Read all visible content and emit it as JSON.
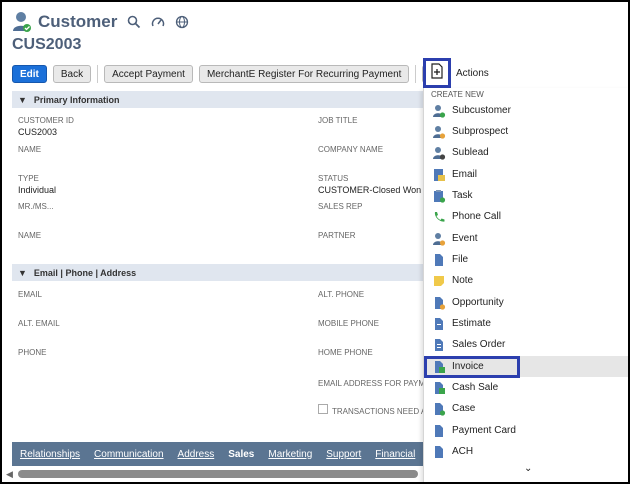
{
  "header": {
    "title": "Customer",
    "record_id": "CUS2003",
    "icons": [
      "customer-person-icon",
      "search-icon",
      "dashboard-gauge-icon",
      "globe-icon"
    ]
  },
  "toolbar": {
    "edit": "Edit",
    "back": "Back",
    "accept_payment": "Accept Payment",
    "merchant_register": "MerchantE Register For Recurring Payment",
    "actions": "Actions"
  },
  "primary": {
    "section_title": "Primary Information",
    "customer_id_label": "CUSTOMER ID",
    "customer_id_value": "CUS2003",
    "job_title_label": "JOB TITLE",
    "name_label": "NAME",
    "company_name_label": "COMPANY NAME",
    "type_label": "TYPE",
    "type_value": "Individual",
    "status_label": "STATUS",
    "status_value": "CUSTOMER-Closed Won",
    "mr_label": "MR./MS...",
    "sales_rep_label": "SALES REP",
    "name2_label": "NAME",
    "partner_label": "PARTNER"
  },
  "contact": {
    "section_title": "Email | Phone | Address",
    "email_label": "EMAIL",
    "alt_phone_label": "ALT. PHONE",
    "alt_email_label": "ALT. EMAIL",
    "mobile_label": "MOBILE PHONE",
    "phone_label": "PHONE",
    "home_phone_label": "HOME PHONE",
    "email_payment_label": "EMAIL ADDRESS FOR PAYME",
    "transactions_label": "TRANSACTIONS NEED AP"
  },
  "tabs": [
    "Relationships",
    "Communication",
    "Address",
    "Sales",
    "Marketing",
    "Support",
    "Financial"
  ],
  "active_tab": "Sales",
  "menu": {
    "header": "CREATE NEW",
    "items": [
      {
        "label": "Subcustomer",
        "icon": "customer-icon"
      },
      {
        "label": "Subprospect",
        "icon": "prospect-icon"
      },
      {
        "label": "Sublead",
        "icon": "lead-icon"
      },
      {
        "label": "Email",
        "icon": "email-icon"
      },
      {
        "label": "Task",
        "icon": "task-icon"
      },
      {
        "label": "Phone Call",
        "icon": "phone-icon"
      },
      {
        "label": "Event",
        "icon": "event-icon"
      },
      {
        "label": "File",
        "icon": "file-icon"
      },
      {
        "label": "Note",
        "icon": "note-icon"
      },
      {
        "label": "Opportunity",
        "icon": "opportunity-icon"
      },
      {
        "label": "Estimate",
        "icon": "estimate-icon"
      },
      {
        "label": "Sales Order",
        "icon": "sales-order-icon"
      },
      {
        "label": "Invoice",
        "icon": "invoice-icon"
      },
      {
        "label": "Cash Sale",
        "icon": "cash-sale-icon"
      },
      {
        "label": "Case",
        "icon": "case-icon"
      },
      {
        "label": "Payment Card",
        "icon": "payment-card-icon"
      },
      {
        "label": "ACH",
        "icon": "ach-icon"
      }
    ],
    "highlighted": "Invoice"
  },
  "colors": {
    "title": "#4d5f79",
    "primary_button": "#1b70d9",
    "highlight_border": "#2c3fae",
    "tab_bar": "#5b7592",
    "section_bar": "#e0e6ef"
  }
}
